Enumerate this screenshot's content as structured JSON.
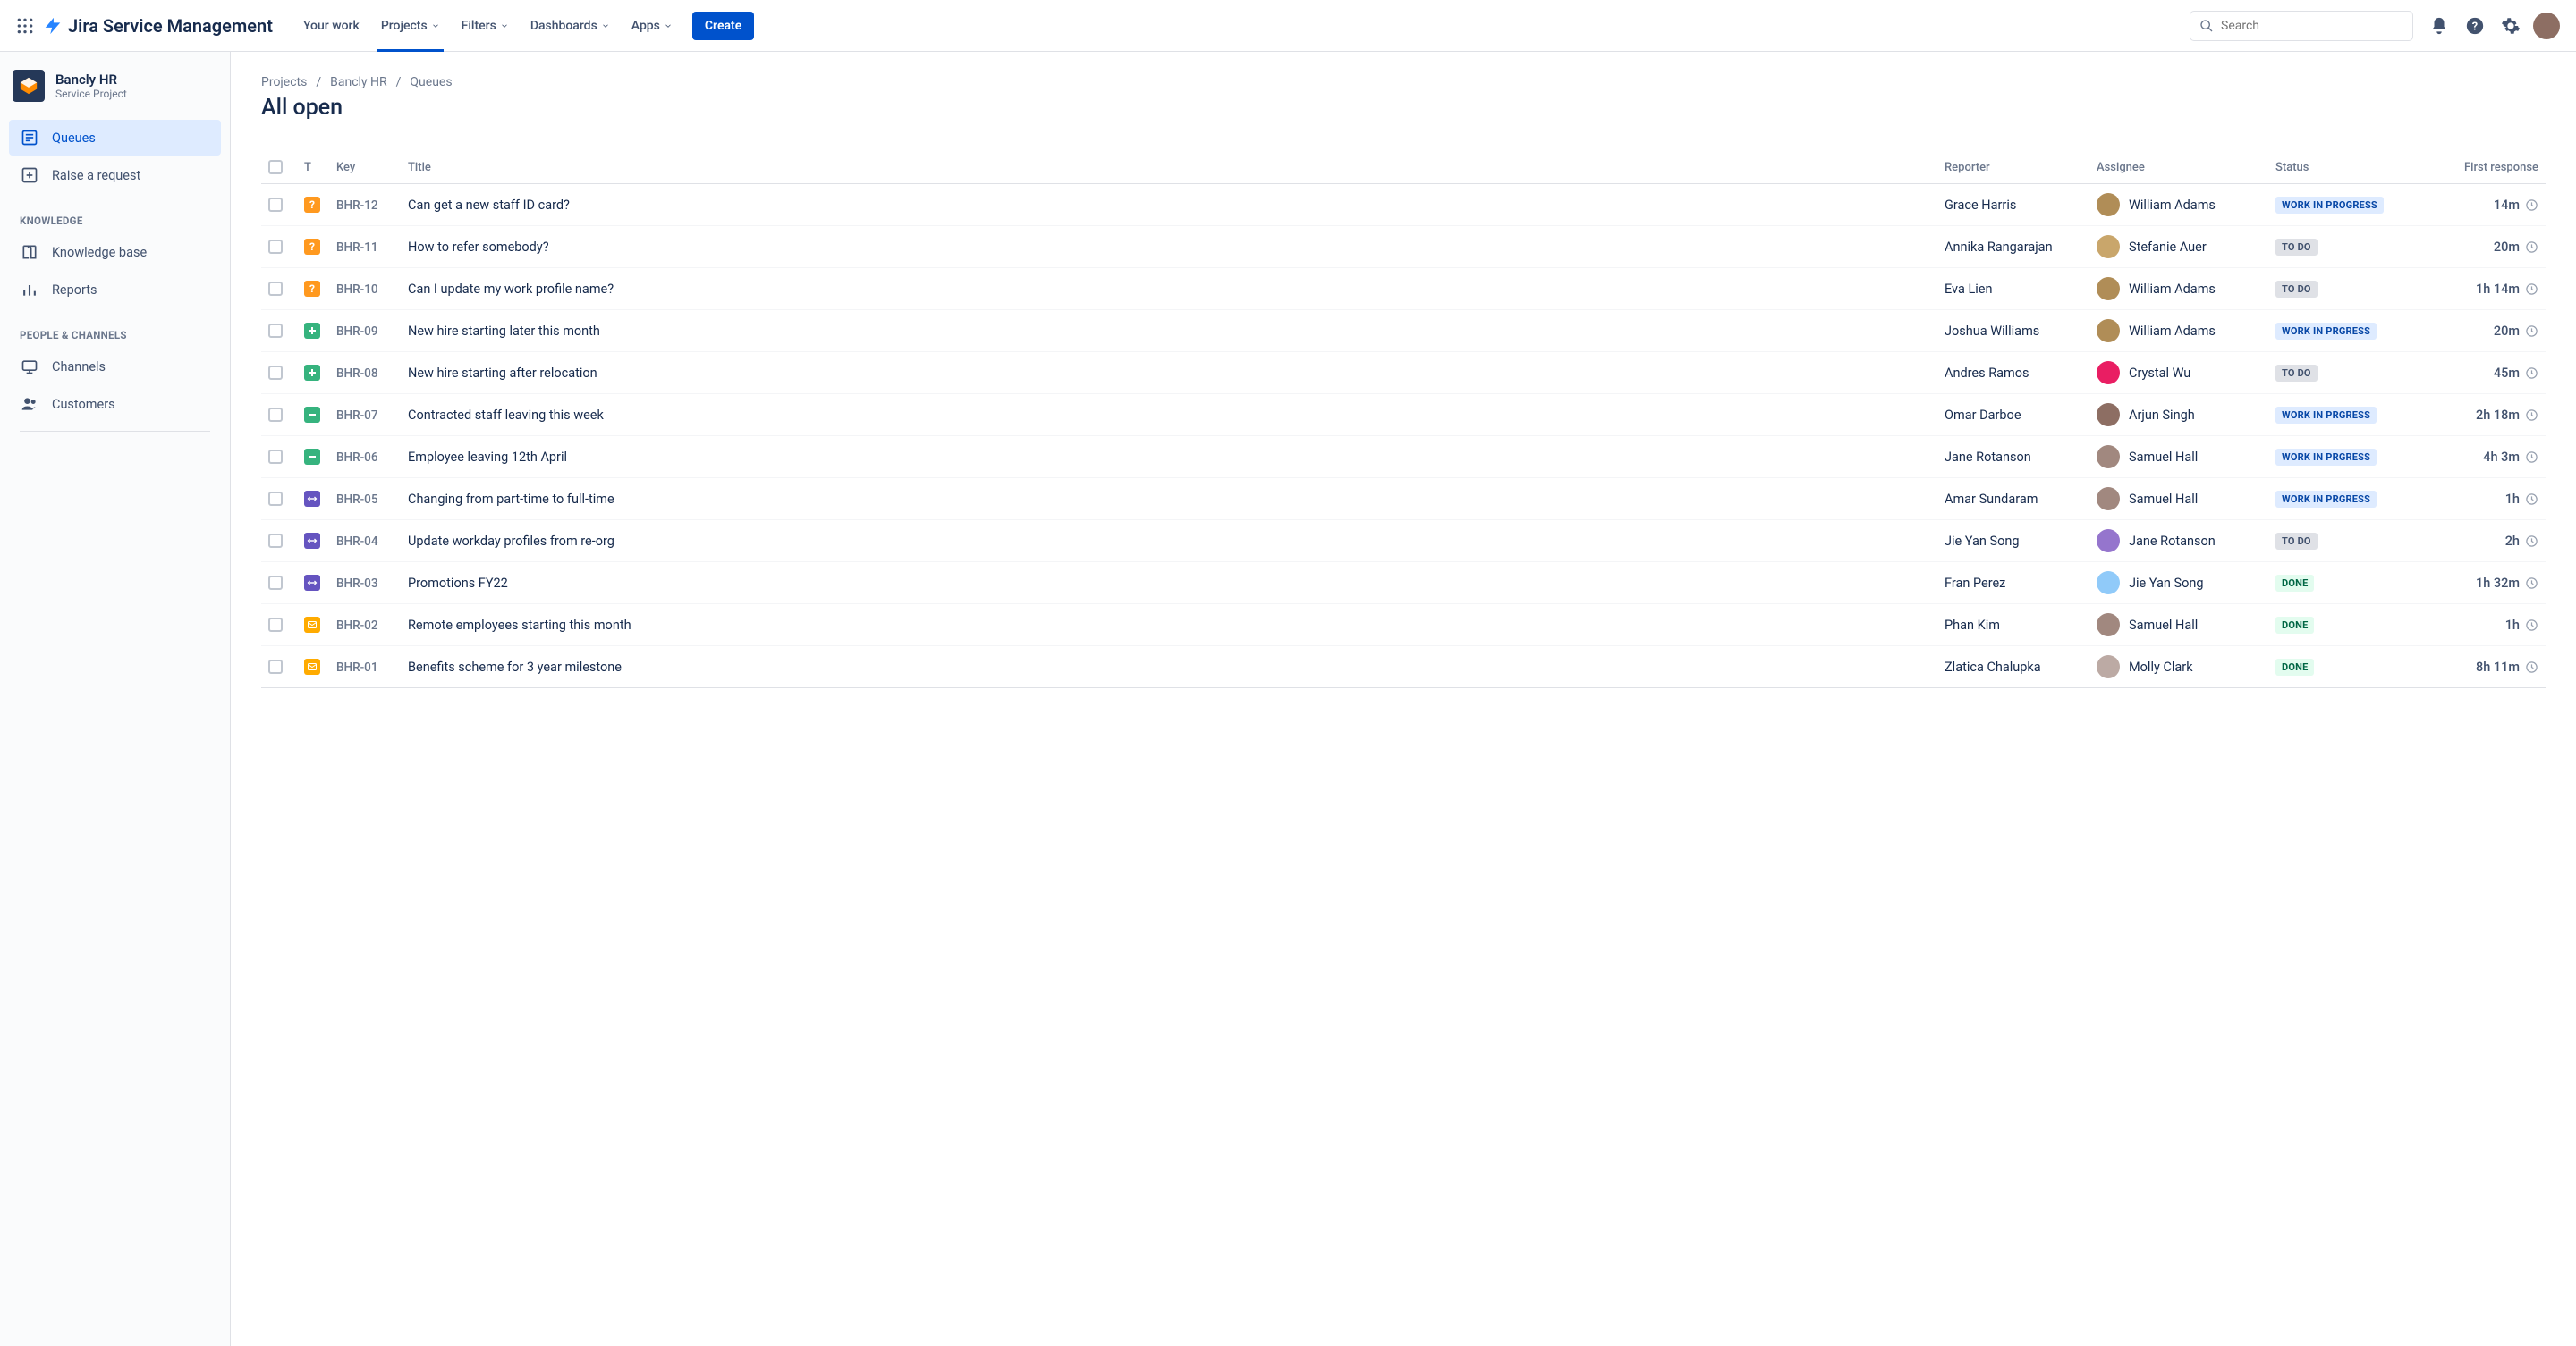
{
  "header": {
    "product_name": "Jira Service Management",
    "nav": [
      {
        "label": "Your work",
        "dropdown": false,
        "active": false
      },
      {
        "label": "Projects",
        "dropdown": true,
        "active": true
      },
      {
        "label": "Filters",
        "dropdown": true,
        "active": false
      },
      {
        "label": "Dashboards",
        "dropdown": true,
        "active": false
      },
      {
        "label": "Apps",
        "dropdown": true,
        "active": false
      }
    ],
    "create_label": "Create",
    "search_placeholder": "Search"
  },
  "sidebar": {
    "project_name": "Bancly HR",
    "project_type": "Service Project",
    "items_primary": [
      {
        "label": "Queues",
        "icon": "queue-icon",
        "active": true
      },
      {
        "label": "Raise a request",
        "icon": "raise-request-icon",
        "active": false
      }
    ],
    "section_knowledge": "KNOWLEDGE",
    "items_knowledge": [
      {
        "label": "Knowledge base",
        "icon": "book-icon"
      },
      {
        "label": "Reports",
        "icon": "reports-icon"
      }
    ],
    "section_people": "PEOPLE & CHANNELS",
    "items_people": [
      {
        "label": "Channels",
        "icon": "channels-icon"
      },
      {
        "label": "Customers",
        "icon": "customers-icon"
      }
    ]
  },
  "breadcrumbs": [
    "Projects",
    "Bancly HR",
    "Queues"
  ],
  "page_title": "All open",
  "table": {
    "columns": [
      "",
      "T",
      "Key",
      "Title",
      "Reporter",
      "Assignee",
      "Status",
      "First response"
    ],
    "rows": [
      {
        "type": "question",
        "key": "BHR-12",
        "title": "Can get a new staff ID card?",
        "reporter": "Grace Harris",
        "assignee": "William Adams",
        "assignee_color": "#B08D57",
        "status": "WORK IN PROGRESS",
        "status_kind": "wip",
        "first_response": "14m"
      },
      {
        "type": "question",
        "key": "BHR-11",
        "title": "How to refer somebody?",
        "reporter": "Annika Rangarajan",
        "assignee": "Stefanie Auer",
        "assignee_color": "#C9A66B",
        "status": "TO DO",
        "status_kind": "todo",
        "first_response": "20m"
      },
      {
        "type": "question",
        "key": "BHR-10",
        "title": "Can I update my work profile name?",
        "reporter": "Eva Lien",
        "assignee": "William Adams",
        "assignee_color": "#B08D57",
        "status": "TO DO",
        "status_kind": "todo",
        "first_response": "1h 14m"
      },
      {
        "type": "plus",
        "key": "BHR-09",
        "title": "New hire starting later this month",
        "reporter": "Joshua Williams",
        "assignee": "William Adams",
        "assignee_color": "#B08D57",
        "status": "WORK IN PRGRESS",
        "status_kind": "wip",
        "first_response": "20m"
      },
      {
        "type": "plus",
        "key": "BHR-08",
        "title": "New hire starting after relocation",
        "reporter": "Andres Ramos",
        "assignee": "Crystal Wu",
        "assignee_color": "#E91E63",
        "status": "TO DO",
        "status_kind": "todo",
        "first_response": "45m"
      },
      {
        "type": "minus",
        "key": "BHR-07",
        "title": "Contracted staff leaving this week",
        "reporter": "Omar Darboe",
        "assignee": "Arjun Singh",
        "assignee_color": "#8D6E63",
        "status": "WORK IN PRGRESS",
        "status_kind": "wip",
        "first_response": "2h 18m"
      },
      {
        "type": "minus",
        "key": "BHR-06",
        "title": "Employee leaving 12th April",
        "reporter": "Jane Rotanson",
        "assignee": "Samuel Hall",
        "assignee_color": "#A1887F",
        "status": "WORK IN PRGRESS",
        "status_kind": "wip",
        "first_response": "4h 3m"
      },
      {
        "type": "swap",
        "key": "BHR-05",
        "title": "Changing from part-time to full-time",
        "reporter": "Amar Sundaram",
        "assignee": "Samuel Hall",
        "assignee_color": "#A1887F",
        "status": "WORK IN PRGRESS",
        "status_kind": "wip",
        "first_response": "1h"
      },
      {
        "type": "swap",
        "key": "BHR-04",
        "title": "Update workday profiles from re-org",
        "reporter": "Jie Yan Song",
        "assignee": "Jane Rotanson",
        "assignee_color": "#9575CD",
        "status": "TO DO",
        "status_kind": "todo",
        "first_response": "2h"
      },
      {
        "type": "swap",
        "key": "BHR-03",
        "title": "Promotions FY22",
        "reporter": "Fran Perez",
        "assignee": "Jie Yan Song",
        "assignee_color": "#90CAF9",
        "status": "DONE",
        "status_kind": "done",
        "first_response": "1h 32m"
      },
      {
        "type": "mail",
        "key": "BHR-02",
        "title": "Remote employees starting this month",
        "reporter": "Phan Kim",
        "assignee": "Samuel Hall",
        "assignee_color": "#A1887F",
        "status": "DONE",
        "status_kind": "done",
        "first_response": "1h"
      },
      {
        "type": "mail",
        "key": "BHR-01",
        "title": "Benefits scheme for 3 year milestone",
        "reporter": "Zlatica Chalupka",
        "assignee": "Molly Clark",
        "assignee_color": "#BCAAA4",
        "status": "DONE",
        "status_kind": "done",
        "first_response": "8h 11m"
      }
    ]
  }
}
